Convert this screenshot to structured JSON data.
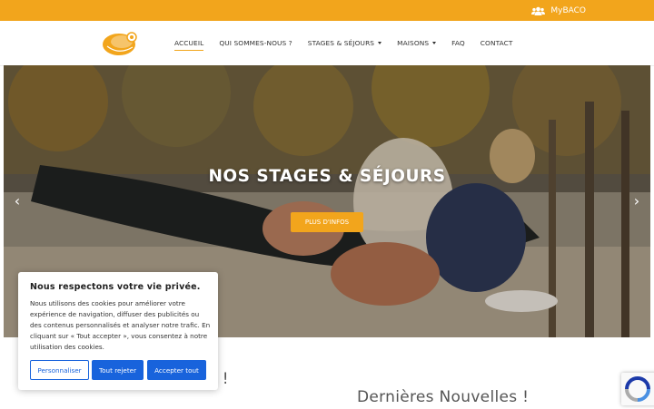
{
  "topbar": {
    "account_label": "MyBACO"
  },
  "nav": {
    "items": [
      {
        "label": "ACCUEIL"
      },
      {
        "label": "QUI SOMMES-NOUS ?"
      },
      {
        "label": "STAGES & SÉJOURS"
      },
      {
        "label": "MAISONS"
      },
      {
        "label": "FAQ"
      },
      {
        "label": "CONTACT"
      }
    ]
  },
  "hero": {
    "title": "NOS STAGES & SÉJOURS",
    "button_label": "PLUS D'INFOS"
  },
  "sections": {
    "welcome_title": "le site de Baco !",
    "news_title": "Dernières Nouvelles !"
  },
  "cookie": {
    "title": "Nous respectons votre vie privée.",
    "text": "Nous utilisons des cookies pour améliorer votre expérience de navigation, diffuser des publicités ou des contenus personnalisés et analyser notre trafic. En cliquant sur « Tout accepter », vous consentez à notre utilisation des cookies.",
    "customize_label": "Personnaliser",
    "reject_label": "Tout rejeter",
    "accept_label": "Accepter tout"
  },
  "colors": {
    "brand_orange": "#f2a51c",
    "cookie_blue": "#1863dc"
  }
}
